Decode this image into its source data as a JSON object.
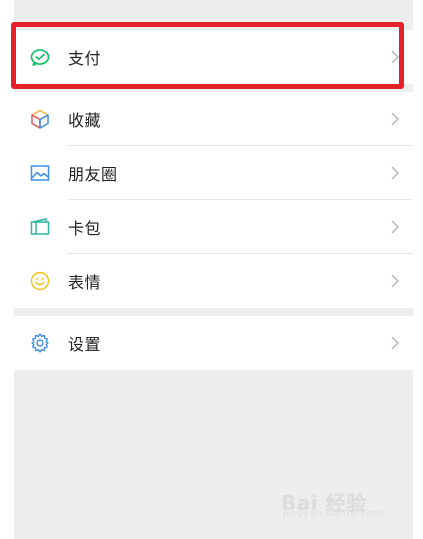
{
  "menu": {
    "groups": [
      {
        "items": [
          {
            "label": "支付",
            "icon": "wechat-pay-icon"
          }
        ]
      },
      {
        "items": [
          {
            "label": "收藏",
            "icon": "favorites-cube-icon"
          },
          {
            "label": "朋友圈",
            "icon": "moments-photo-icon"
          },
          {
            "label": "卡包",
            "icon": "card-wallet-icon"
          },
          {
            "label": "表情",
            "icon": "sticker-smile-icon"
          }
        ]
      },
      {
        "items": [
          {
            "label": "设置",
            "icon": "settings-gear-icon"
          }
        ]
      }
    ]
  },
  "colors": {
    "background": "#ededed",
    "highlight": "#e4202a",
    "pay_green": "#07c160",
    "blue": "#3e8ee8"
  },
  "watermark": {
    "text": "Bai 经验",
    "sub": "jingyan.baidu.com"
  }
}
